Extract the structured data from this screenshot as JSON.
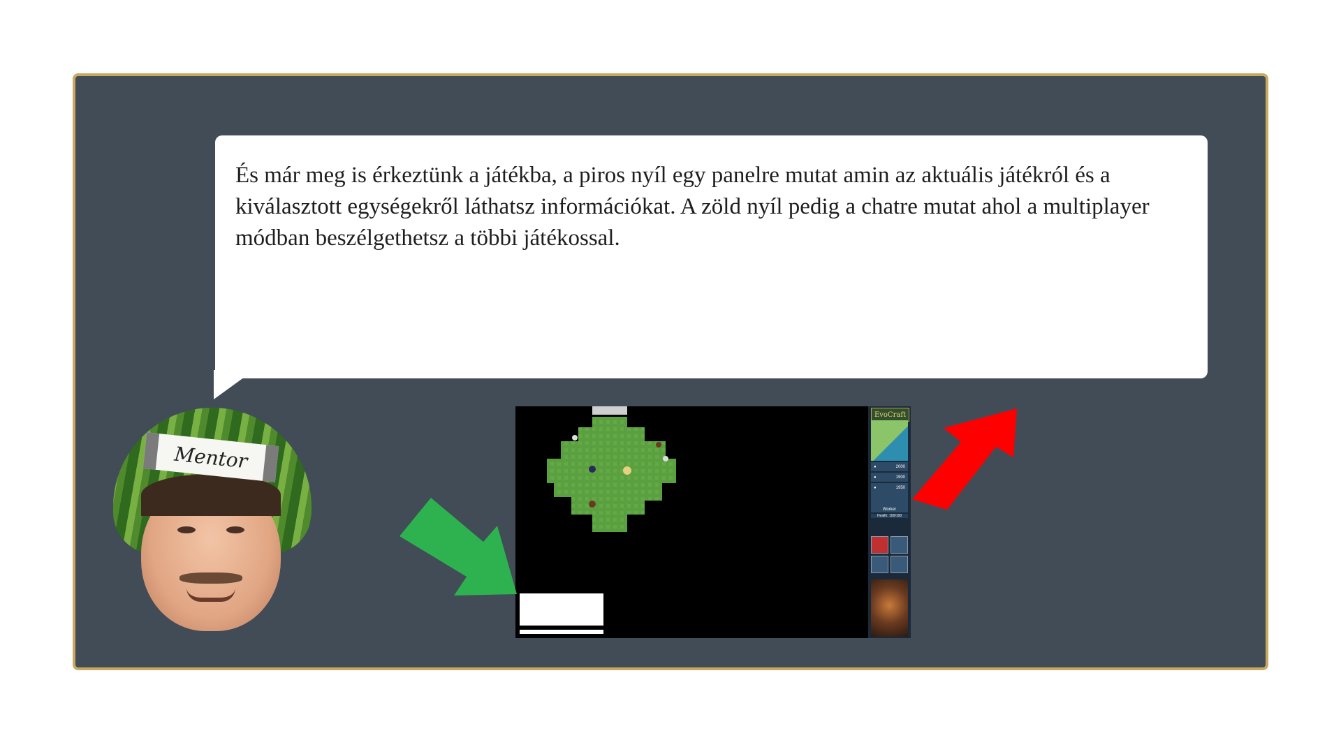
{
  "dialog": {
    "text": "És már meg is érkeztünk a játékba, a piros nyíl egy panelre mutat amin az aktuális játékról és a kiválasztott egységekről láthatsz információkat. A zöld nyíl pedig a chatre mutat ahol a multiplayer módban beszélgethetsz a többi játékossal."
  },
  "mentor": {
    "label": "Mentor"
  },
  "game": {
    "logo": "EvoCraft",
    "resources": [
      {
        "icon": "gold-icon",
        "value": "2000"
      },
      {
        "icon": "food-icon",
        "value": "1900"
      },
      {
        "icon": "wood-icon",
        "value": "1950"
      }
    ],
    "selected_unit": {
      "name": "Worker",
      "health": "Health: 100/100"
    }
  },
  "colors": {
    "frame_bg": "#414c57",
    "frame_border": "#c9a95f",
    "red_arrow": "#ff0000",
    "green_arrow": "#2eb24f"
  }
}
